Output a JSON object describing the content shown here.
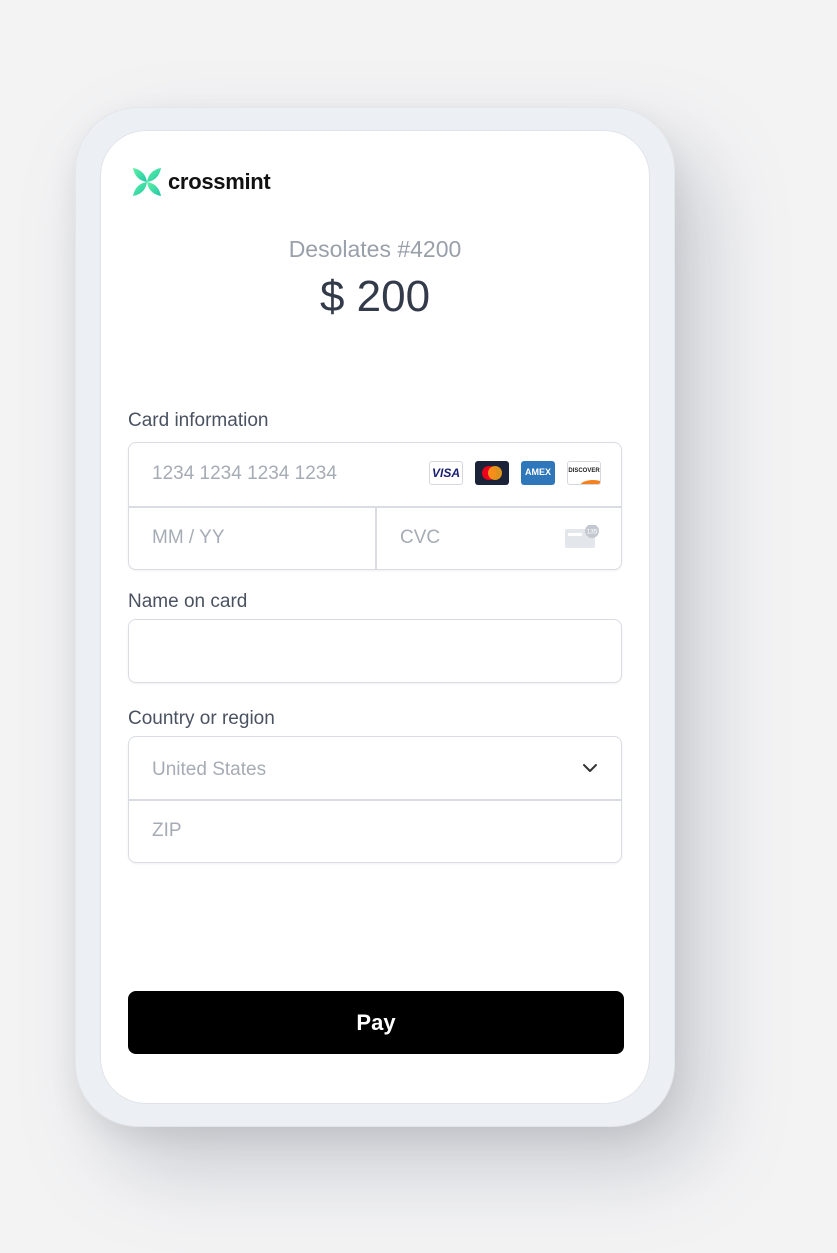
{
  "brand": {
    "name": "crossmint",
    "accent": "#2fd98e"
  },
  "product": {
    "name": "Desolates #4200",
    "price": "$ 200"
  },
  "card_info": {
    "label": "Card information",
    "number_placeholder": "1234 1234 1234 1234",
    "expiry_placeholder": "MM / YY",
    "cvc_placeholder": "CVC",
    "cvc_icon_text": "135",
    "brands": [
      "VISA",
      "mastercard",
      "AMEX",
      "DISCOVER"
    ]
  },
  "name_on_card": {
    "label": "Name on card",
    "value": ""
  },
  "country": {
    "label": "Country or region",
    "selected": "United States",
    "zip_placeholder": "ZIP"
  },
  "pay_button": {
    "label": "Pay",
    "color": "#000000"
  }
}
